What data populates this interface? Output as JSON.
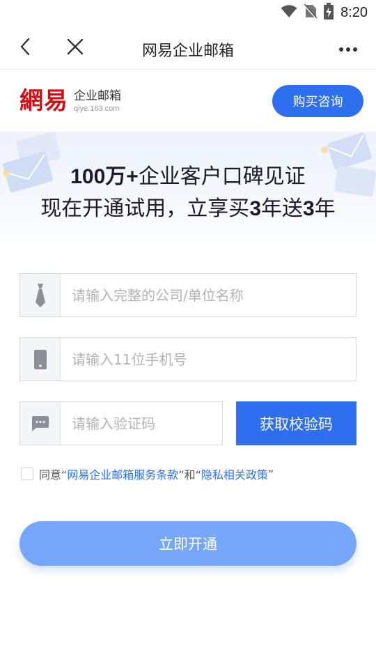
{
  "status_bar": {
    "time": "8:20",
    "icons": [
      "wifi-icon",
      "no-sim-icon",
      "battery-charging-icon"
    ]
  },
  "nav": {
    "title": "网易企业邮箱",
    "icons": [
      "chevron-left-icon",
      "close-icon",
      "more-icon"
    ]
  },
  "brand": {
    "logo_mark": "網易",
    "logo_name": "企业邮箱",
    "logo_domain": "qiye.163.com",
    "consult_label": "购买咨询"
  },
  "banner": {
    "line1_num": "100万+",
    "line1_rest": "企业客户口碑见证",
    "line2_a": "现在开通试用，立享买",
    "line2_num1": "3",
    "line2_b": "年送",
    "line2_num2": "3",
    "line2_c": "年"
  },
  "form": {
    "company": {
      "placeholder": "请输入完整的公司/单位名称",
      "value": "",
      "icon": "tie-icon"
    },
    "phone": {
      "placeholder": "请输入11位手机号",
      "value": "",
      "icon": "phone-icon"
    },
    "code": {
      "placeholder": "请输入验证码",
      "value": "",
      "icon": "message-icon"
    },
    "get_code_label": "获取校验码"
  },
  "agreement": {
    "prefix": "同意“",
    "terms": "网易企业邮箱服务条款",
    "middle": "”和“",
    "privacy": "隐私相关政策",
    "suffix": "”",
    "checked": false
  },
  "submit_label": "立即开通",
  "colors": {
    "primary": "#2e6ff0",
    "submit_disabled": "#76a6f7",
    "brand_red": "#d20e17"
  }
}
